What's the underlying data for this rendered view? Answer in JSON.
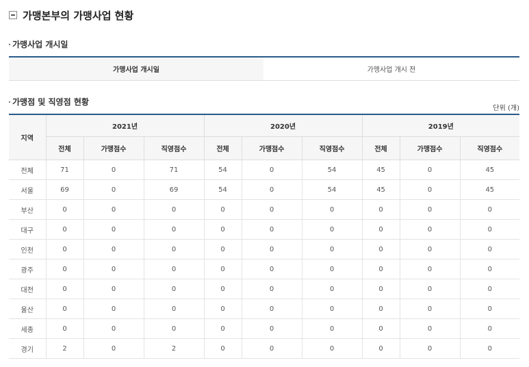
{
  "main_title": "가맹본부의 가맹사업 현황",
  "start_section": {
    "heading": "가맹사업 개시일",
    "label": "가맹사업 개시일",
    "value": "가맹사업 개시 전"
  },
  "status_section": {
    "heading": "가맹점 및 직영점 현황",
    "unit": "단위 (개)",
    "region_header": "지역",
    "years": [
      "2021년",
      "2020년",
      "2019년"
    ],
    "sub_headers": [
      "전체",
      "가맹점수",
      "직영점수"
    ],
    "rows": [
      {
        "region": "전체",
        "values": [
          "71",
          "0",
          "71",
          "54",
          "0",
          "54",
          "45",
          "0",
          "45"
        ]
      },
      {
        "region": "서울",
        "values": [
          "69",
          "0",
          "69",
          "54",
          "0",
          "54",
          "45",
          "0",
          "45"
        ]
      },
      {
        "region": "부산",
        "values": [
          "0",
          "0",
          "0",
          "0",
          "0",
          "0",
          "0",
          "0",
          "0"
        ]
      },
      {
        "region": "대구",
        "values": [
          "0",
          "0",
          "0",
          "0",
          "0",
          "0",
          "0",
          "0",
          "0"
        ]
      },
      {
        "region": "인천",
        "values": [
          "0",
          "0",
          "0",
          "0",
          "0",
          "0",
          "0",
          "0",
          "0"
        ]
      },
      {
        "region": "광주",
        "values": [
          "0",
          "0",
          "0",
          "0",
          "0",
          "0",
          "0",
          "0",
          "0"
        ]
      },
      {
        "region": "대전",
        "values": [
          "0",
          "0",
          "0",
          "0",
          "0",
          "0",
          "0",
          "0",
          "0"
        ]
      },
      {
        "region": "울산",
        "values": [
          "0",
          "0",
          "0",
          "0",
          "0",
          "0",
          "0",
          "0",
          "0"
        ]
      },
      {
        "region": "세종",
        "values": [
          "0",
          "0",
          "0",
          "0",
          "0",
          "0",
          "0",
          "0",
          "0"
        ]
      },
      {
        "region": "경기",
        "values": [
          "2",
          "0",
          "2",
          "0",
          "0",
          "0",
          "0",
          "0",
          "0"
        ]
      }
    ]
  },
  "colors": {
    "table_top_border": "#2a5a8a",
    "header_background": "#f6f6f6"
  }
}
